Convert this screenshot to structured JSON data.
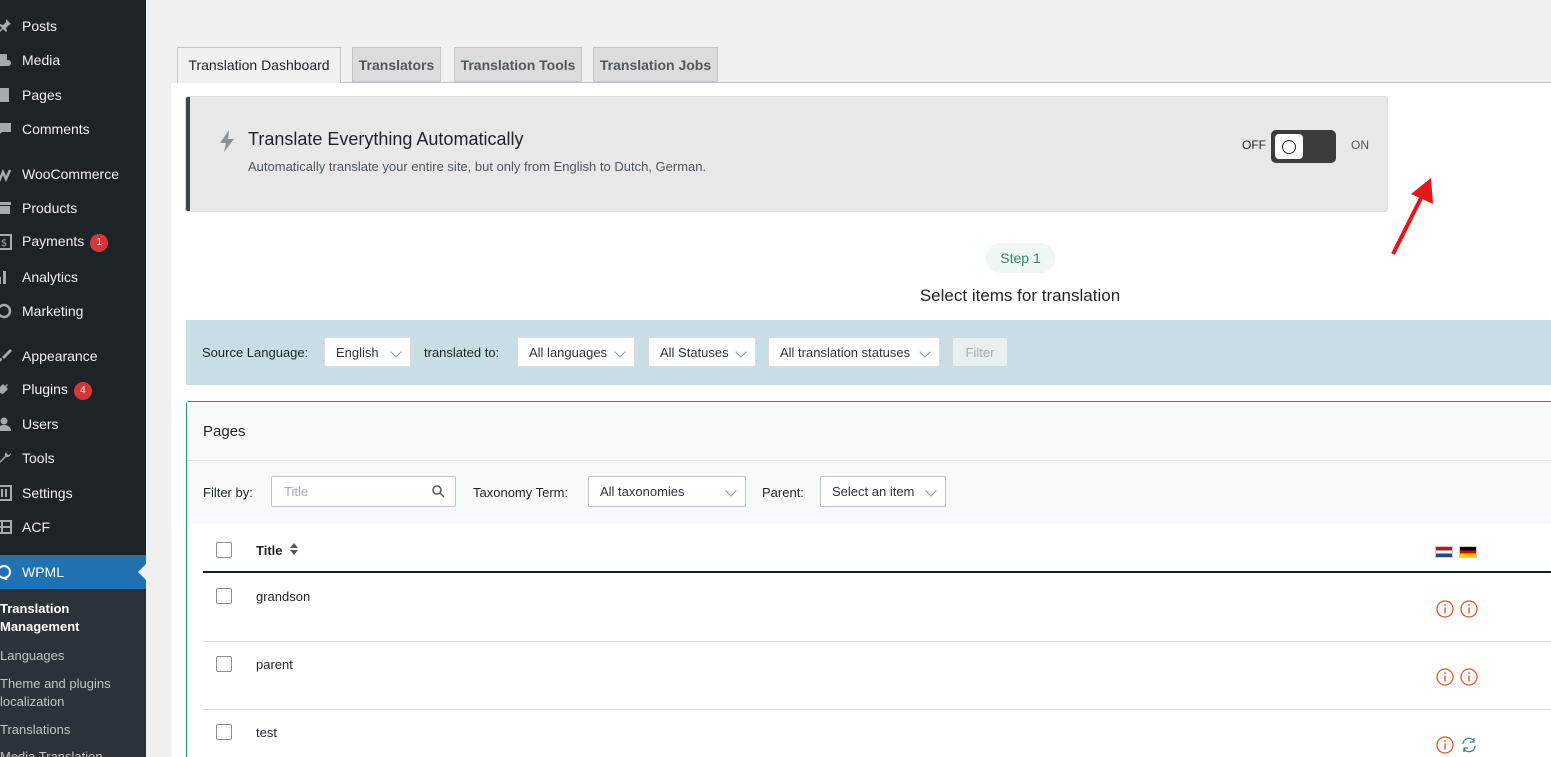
{
  "sidebar": {
    "items": [
      {
        "label": "Posts",
        "icon": "pin-icon"
      },
      {
        "label": "Media",
        "icon": "media-icon"
      },
      {
        "label": "Pages",
        "icon": "page-icon"
      },
      {
        "label": "Comments",
        "icon": "comment-icon"
      },
      {
        "label": "WooCommerce",
        "icon": "woocommerce-icon"
      },
      {
        "label": "Products",
        "icon": "archive-icon"
      },
      {
        "label": "Payments",
        "icon": "dollar-icon",
        "badge": "1"
      },
      {
        "label": "Analytics",
        "icon": "bar-chart-icon"
      },
      {
        "label": "Marketing",
        "icon": "megaphone-icon"
      },
      {
        "label": "Appearance",
        "icon": "brush-icon"
      },
      {
        "label": "Plugins",
        "icon": "plug-icon",
        "badge": "4"
      },
      {
        "label": "Users",
        "icon": "user-icon"
      },
      {
        "label": "Tools",
        "icon": "wrench-icon"
      },
      {
        "label": "Settings",
        "icon": "sliders-icon"
      },
      {
        "label": "ACF",
        "icon": "grid-icon"
      },
      {
        "label": "WPML",
        "icon": "wpml-icon"
      }
    ],
    "submenu": [
      "Translation Management",
      "Languages",
      "Theme and plugins localization",
      "Translations",
      "Media Translation"
    ]
  },
  "tabs": [
    "Translation Dashboard",
    "Translators",
    "Translation Tools",
    "Translation Jobs"
  ],
  "auto_translate": {
    "title": "Translate Everything Automatically",
    "description": "Automatically translate your entire site, but only from English to Dutch, German.",
    "off_label": "OFF",
    "on_label": "ON",
    "enabled": false
  },
  "step": {
    "pill": "Step 1",
    "title": "Select items for translation"
  },
  "filters": {
    "source_label": "Source Language:",
    "source_value": "English",
    "translated_to_label": "translated to:",
    "languages_value": "All languages",
    "statuses_value": "All Statuses",
    "translation_statuses_value": "All translation statuses",
    "filter_button": "Filter"
  },
  "pages_section": {
    "title": "Pages",
    "filter_by_label": "Filter by:",
    "title_placeholder": "Title",
    "taxonomy_label": "Taxonomy Term:",
    "taxonomy_value": "All taxonomies",
    "parent_label": "Parent:",
    "parent_value": "Select an item",
    "column_title": "Title",
    "flags": [
      "Dutch flag",
      "German flag"
    ],
    "rows": [
      {
        "title": "grandson",
        "statuses": [
          "info-icon",
          "info-icon"
        ]
      },
      {
        "title": "parent",
        "statuses": [
          "info-icon",
          "info-icon"
        ]
      },
      {
        "title": "test",
        "statuses": [
          "info-icon",
          "refresh-icon"
        ]
      }
    ]
  },
  "colors": {
    "sidebar_bg": "#1d2327",
    "active_menu": "#2271b1",
    "accent_green": "#2f8a6c",
    "filter_bar_bg": "#c9dde4",
    "status_warning": "#d35a2e",
    "annotation_arrow": "#e5161b"
  }
}
